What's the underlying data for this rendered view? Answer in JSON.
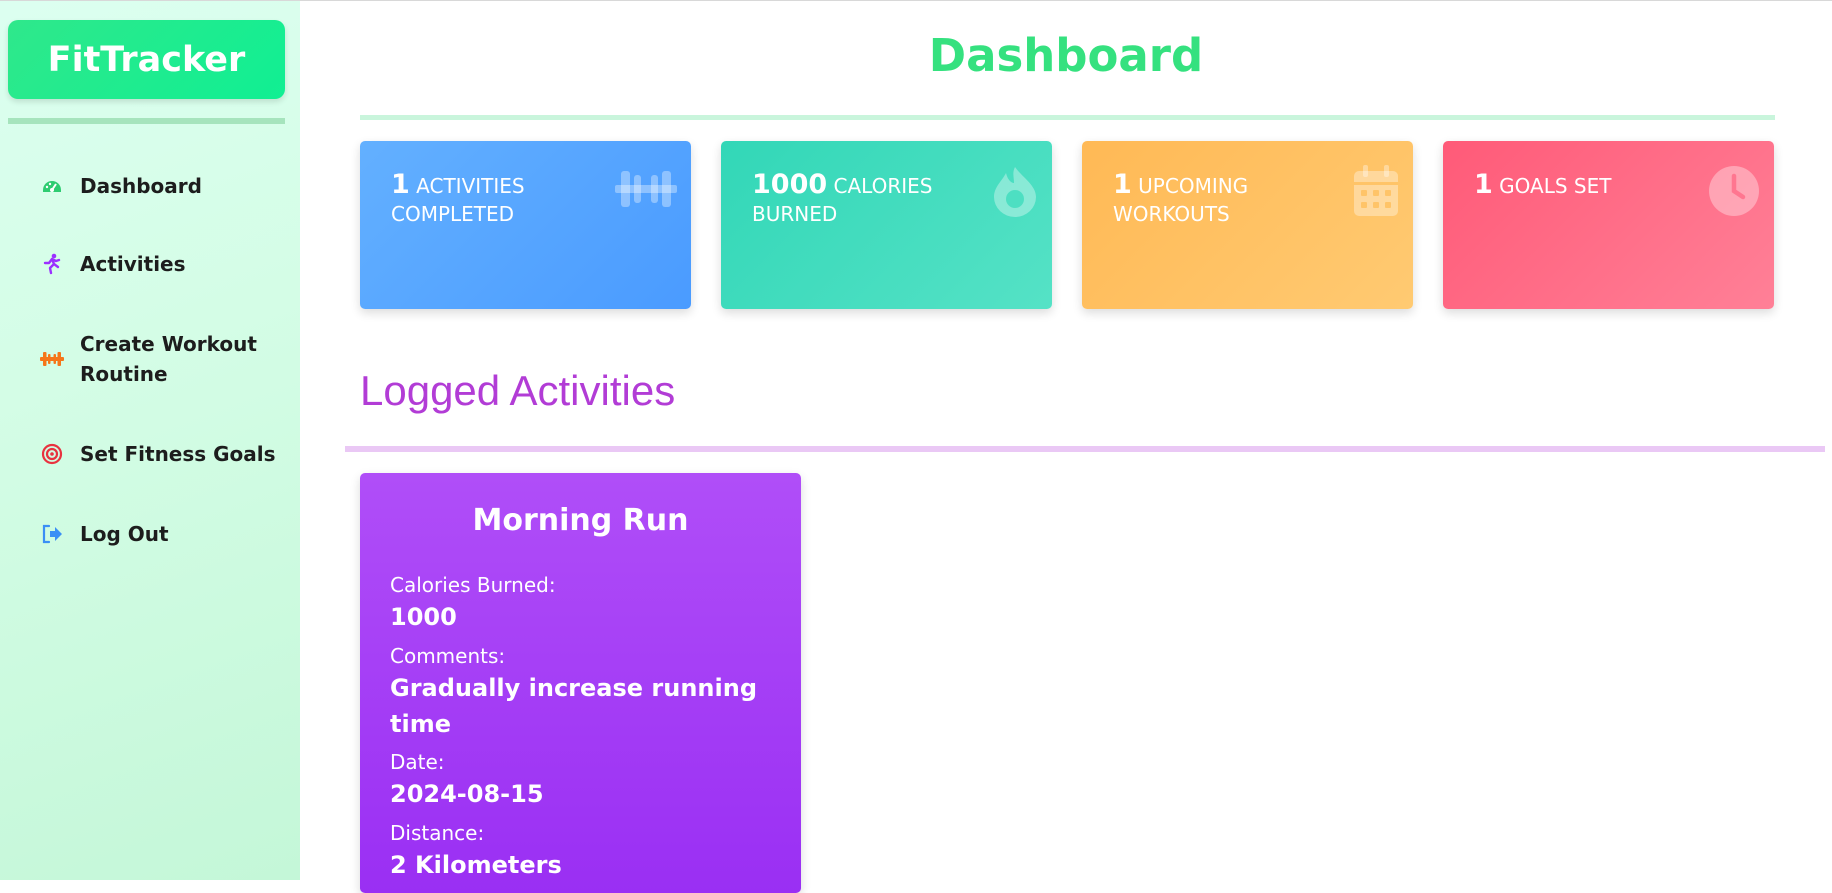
{
  "brand": {
    "name": "FitTracker"
  },
  "sidebar": {
    "items": [
      {
        "label": "Dashboard",
        "icon": "gauge-icon",
        "color": "#2ecc71"
      },
      {
        "label": "Activities",
        "icon": "running-person-icon",
        "color": "#9b30ff"
      },
      {
        "label": "Create Workout Routine",
        "icon": "dumbbell-icon",
        "color": "#f5761a"
      },
      {
        "label": "Set Fitness Goals",
        "icon": "target-icon",
        "color": "#e8323f"
      },
      {
        "label": "Log Out",
        "icon": "logout-icon",
        "color": "#3b8ff5"
      }
    ]
  },
  "main": {
    "title": "Dashboard"
  },
  "stats": [
    {
      "value": "1",
      "label": "ACTIVITIES COMPLETED",
      "icon": "dumbbell-icon",
      "color": "#5aa7ff"
    },
    {
      "value": "1000",
      "label": "CALORIES BURNED",
      "icon": "flame-icon",
      "color": "#3fdbbb"
    },
    {
      "value": "1",
      "label": "UPCOMING WORKOUTS",
      "icon": "calendar-icon",
      "color": "#ffc062"
    },
    {
      "value": "1",
      "label": "GOALS SET",
      "icon": "clock-icon",
      "color": "#ff6b86"
    }
  ],
  "logged": {
    "title": "Logged Activities",
    "activities": [
      {
        "name": "Morning Run",
        "calories_label": "Calories Burned:",
        "calories": "1000",
        "comments_label": "Comments:",
        "comments": "Gradually increase running time",
        "date_label": "Date:",
        "date": "2024-08-15",
        "distance_label": "Distance:",
        "distance": "2 Kilometers"
      }
    ]
  }
}
